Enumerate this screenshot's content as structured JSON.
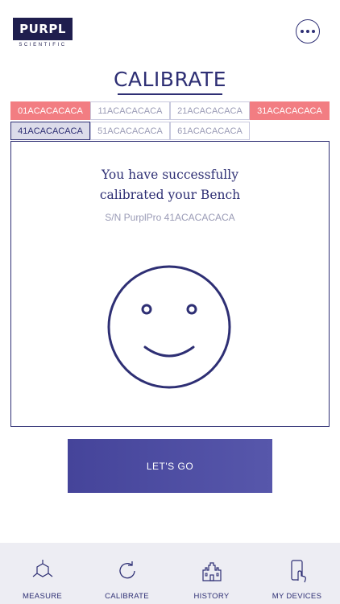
{
  "brand": {
    "name": "PURPL",
    "tagline": "SCIENTIFIC"
  },
  "header": {
    "menu_icon": "more-horizontal-icon"
  },
  "page": {
    "title": "CALIBRATE"
  },
  "devices": [
    {
      "label": "01ACACACACA",
      "state": "error"
    },
    {
      "label": "11ACACACACA",
      "state": "idle"
    },
    {
      "label": "21ACACACACA",
      "state": "idle"
    },
    {
      "label": "31ACACACACA",
      "state": "error"
    },
    {
      "label": "41ACACACACA",
      "state": "active"
    },
    {
      "label": "51ACACACACA",
      "state": "idle"
    },
    {
      "label": "61ACACACACA",
      "state": "idle"
    }
  ],
  "result": {
    "line1": "You have successfully",
    "line2": "calibrated your Bench",
    "serial": "S/N PurplPro 41ACACACACA",
    "icon": "smiley-face-icon"
  },
  "cta": {
    "label": "LET'S GO"
  },
  "nav": [
    {
      "label": "MEASURE",
      "icon": "molecule-icon"
    },
    {
      "label": "CALIBRATE",
      "icon": "refresh-icon"
    },
    {
      "label": "HISTORY",
      "icon": "castle-icon"
    },
    {
      "label": "MY DEVICES",
      "icon": "phone-touch-icon"
    }
  ],
  "colors": {
    "primary": "#2e2f74",
    "error": "#f27d82",
    "active": "#dcdcea",
    "button": "#4e4ea6"
  }
}
